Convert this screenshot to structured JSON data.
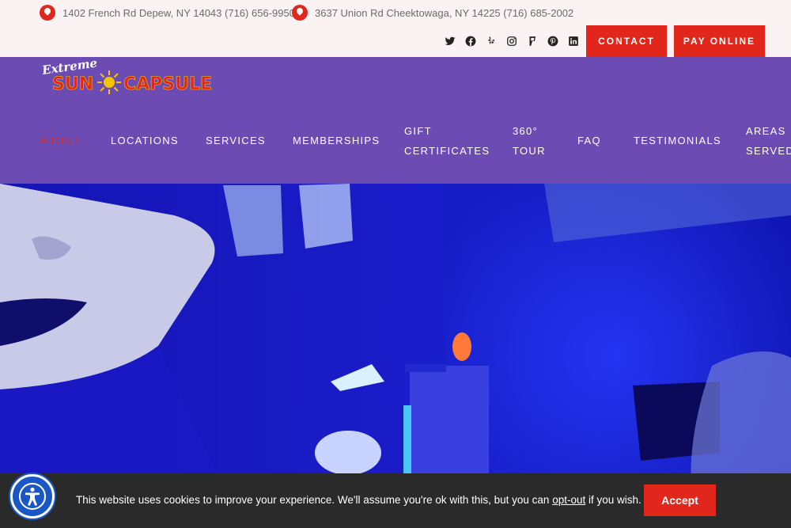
{
  "topbar": {
    "address1": "1402 French Rd Depew, NY 14043 (716) 656-9950",
    "address2": "3637 Union Rd Cheektowaga, NY 14225 (716) 685-2002",
    "socials": [
      "twitter-icon",
      "facebook-icon",
      "yelp-icon",
      "instagram-icon",
      "foursquare-icon",
      "pinterest-icon",
      "linkedin-icon"
    ],
    "contact_label": "CONTACT",
    "pay_label": "PAY ONLINE"
  },
  "logo": {
    "word1": "Extreme",
    "word2": "SUN",
    "word3": "CAPSULE"
  },
  "nav": {
    "items": [
      {
        "line1": "ABOUT",
        "line2": ""
      },
      {
        "line1": "LOCATIONS",
        "line2": ""
      },
      {
        "line1": "SERVICES",
        "line2": ""
      },
      {
        "line1": "MEMBERSHIPS",
        "line2": ""
      },
      {
        "line1": "GIFT",
        "line2": "CERTIFICATES"
      },
      {
        "line1": "360°",
        "line2": "TOUR"
      },
      {
        "line1": "FAQ",
        "line2": ""
      },
      {
        "line1": "TESTIMONIALS",
        "line2": ""
      },
      {
        "line1": "AREAS",
        "line2": "SERVED"
      }
    ]
  },
  "cookie": {
    "text_before": "This website uses cookies to improve your experience. We'll assume you're ok with this, but you can ",
    "link": "opt-out",
    "text_after": " if you wish.",
    "accept_label": "Accept"
  },
  "colors": {
    "brand_red": "#e1261c",
    "nav_purple": "#6c4cb3",
    "hero_blue": "#1a20d8"
  }
}
